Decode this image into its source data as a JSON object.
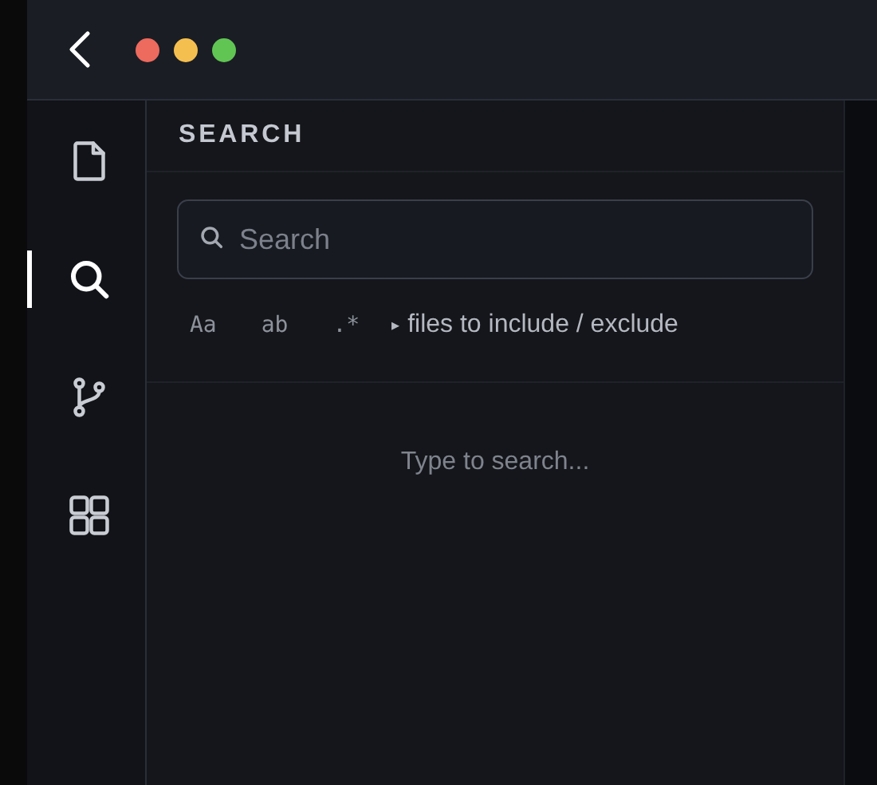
{
  "activity_bar": {
    "items": [
      {
        "kind": "file",
        "selected": false
      },
      {
        "kind": "search",
        "selected": true
      },
      {
        "kind": "branch",
        "selected": false
      },
      {
        "kind": "grid",
        "selected": false
      }
    ]
  },
  "panel": {
    "title": "SEARCH",
    "search": {
      "placeholder": "Search"
    },
    "toggles": [
      {
        "label": "Aa",
        "selected": false
      },
      {
        "label": "ab",
        "selected": false
      },
      {
        "label": ".*",
        "selected": false
      }
    ],
    "disclosure": {
      "marker": "▸",
      "label": "files to include / exclude",
      "expanded": false
    },
    "empty_message": "Type to search..."
  }
}
